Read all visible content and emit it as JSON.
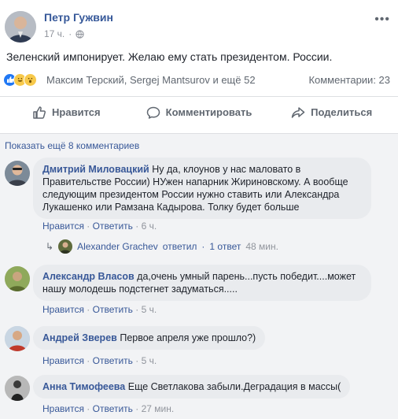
{
  "post": {
    "author": "Петр Гужвин",
    "time": "17 ч.",
    "separator": "·",
    "text": "Зеленский импонирует. Желаю ему стать президентом. России.",
    "reactors": "Максим Терский, Sergej Mantsurov и ещё 52",
    "comments_count": "Комментарии: 23",
    "more_icon": "ellipsis-icon",
    "actions": {
      "like": "Нравится",
      "comment": "Комментировать",
      "share": "Поделиться"
    }
  },
  "comments": {
    "show_more": "Показать ещё 8 комментариев",
    "like_label": "Нравится",
    "reply_label": "Ответить",
    "dot": "·",
    "items": [
      {
        "name": "Дмитрий Миловацкий",
        "text": "Ну да, клоунов у нас маловато в Правительстве России) НУжен напарник Жириновскому. А вообще следующим президентом России нужно ставить или Александра Лукашенко или Рамзана Кадырова. Толку будет больше",
        "time": "6 ч."
      },
      {
        "name": "Александр Власов",
        "text": "да,очень умный парень...пусть победит....может нашу молодешь подстегнет задуматься.....",
        "time": "5 ч."
      },
      {
        "name": "Андрей Зверев",
        "text": "Первое апреля уже прошло?)",
        "time": "5 ч."
      },
      {
        "name": "Анна Тимофеева",
        "text": "Еще Светлакова забыли.Деградация в массы(",
        "time": "27 мин."
      }
    ],
    "reply": {
      "name": "Alexander Grachev",
      "verb": "ответил",
      "count": "1 ответ",
      "time": "48 мин."
    }
  },
  "colors": {
    "link": "#385898",
    "author": "#365899",
    "bubble": "#e9ebee",
    "meta": "#90949c",
    "like_blue": "#2078f4"
  }
}
